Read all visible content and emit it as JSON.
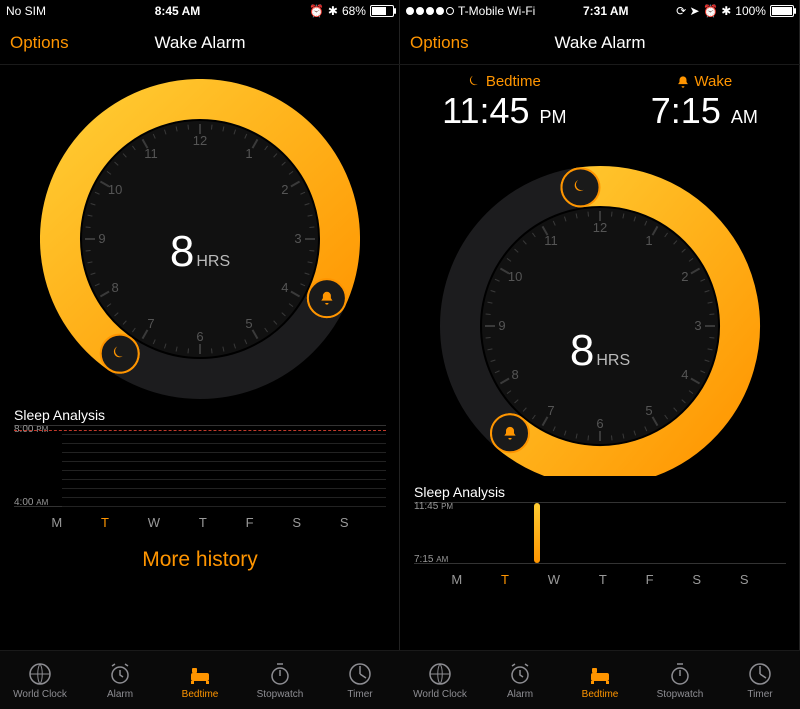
{
  "left": {
    "status": {
      "carrier": "No SIM",
      "time": "8:45 AM",
      "alarm": "⏰",
      "bluetooth": "✱",
      "battery_pct": "68%",
      "battery_fill": 68
    },
    "nav": {
      "title": "Wake Alarm",
      "options": "Options"
    },
    "dial": {
      "hours_num": "8",
      "hours_unit": "HRS",
      "arc_start_deg": 215,
      "arc_end_deg": 115,
      "radius": 140
    },
    "sleep": {
      "title": "Sleep Analysis",
      "top_time": "8:00",
      "top_period": "PM",
      "bottom_time": "4:00",
      "bottom_period": "AM",
      "days": [
        "M",
        "T",
        "W",
        "T",
        "F",
        "S",
        "S"
      ],
      "active_day_index": 1
    },
    "more_history": "More history"
  },
  "right": {
    "status": {
      "carrier": "T-Mobile Wi-Fi",
      "time": "7:31 AM",
      "icons": "⟳ ➤ ⏰ ✱",
      "battery_pct": "100%",
      "battery_fill": 100
    },
    "nav": {
      "title": "Wake Alarm",
      "options": "Options"
    },
    "bedtime": {
      "label": "Bedtime",
      "value": "11:45",
      "period": "PM"
    },
    "wake": {
      "label": "Wake",
      "value": "7:15",
      "period": "AM"
    },
    "dial": {
      "hours_num": "8",
      "hours_unit": "HRS",
      "arc_start_deg": -8,
      "arc_end_deg": 220,
      "radius": 140
    },
    "sleep": {
      "title": "Sleep Analysis",
      "top_time": "11:45",
      "top_period": "PM",
      "bottom_time": "7:15",
      "bottom_period": "AM",
      "days": [
        "M",
        "T",
        "W",
        "T",
        "F",
        "S",
        "S"
      ],
      "active_day_index": 1
    }
  },
  "tabs": {
    "items": [
      {
        "label": "World Clock"
      },
      {
        "label": "Alarm"
      },
      {
        "label": "Bedtime"
      },
      {
        "label": "Stopwatch"
      },
      {
        "label": "Timer"
      }
    ],
    "active_index": 2
  },
  "clock_numbers": [
    "12",
    "1",
    "2",
    "3",
    "4",
    "5",
    "6",
    "7",
    "8",
    "9",
    "10",
    "11"
  ],
  "colors": {
    "accent": "#ff9500",
    "accent_light": "#ffcc33"
  }
}
